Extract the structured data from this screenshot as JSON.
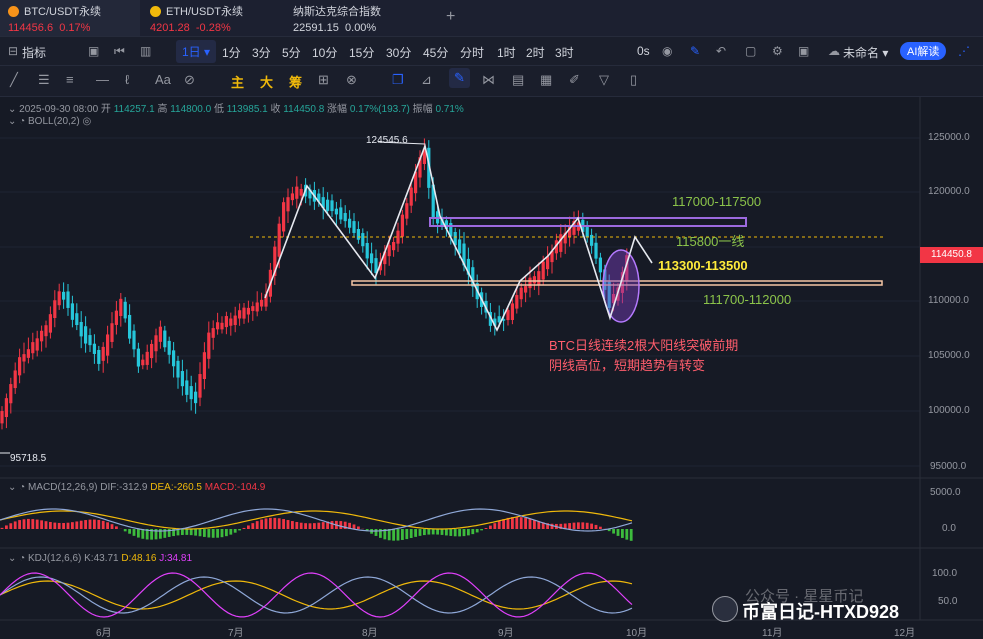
{
  "tabs": [
    {
      "name": "BTC/USDT永续",
      "price": "114456.6",
      "change": "0.17%",
      "color": "#f23645"
    },
    {
      "name": "ETH/USDT永续",
      "price": "4201.28",
      "change": "-0.28%",
      "color": "#f23645"
    },
    {
      "name": "纳斯达克综合指数",
      "price": "22591.15",
      "change": "0.00%",
      "color": "#d1d4dc"
    }
  ],
  "add_tab": "+",
  "toolbar": {
    "indicators": "指标",
    "active_interval": "1日",
    "intervals": [
      "1分",
      "3分",
      "5分",
      "10分",
      "15分",
      "30分",
      "45分",
      "分时",
      "1时",
      "2时",
      "3时"
    ],
    "time_label": "0s",
    "layout_name": "未命名",
    "ai_button": "AI解读"
  },
  "drawing_tools": [
    "主",
    "大",
    "筹"
  ],
  "ohlc": {
    "date": "2025-09-30 08:00",
    "open_label": "开",
    "open": "114257.1",
    "high_label": "高",
    "high": "114800.0",
    "low_label": "低",
    "low": "113985.1",
    "close_label": "收",
    "close": "114450.8",
    "chg_label": "涨幅",
    "chg": "0.17%(193.7)",
    "amp_label": "振幅",
    "amp": "0.71%"
  },
  "boll_label": "BOLL(20,2)",
  "price_axis": [
    "125000.0",
    "120000.0",
    "110000.0",
    "105000.0",
    "100000.0",
    "95000.0"
  ],
  "current_price": "114450.8",
  "high_marker": "124545.6",
  "low_marker": "95718.5",
  "annotations": {
    "zone1": "117000-117500",
    "line1": "115800一线",
    "zone2": "113300-113500",
    "zone3": "111700-112000",
    "note_line1": "BTC日线连续2根大阳线突破前期",
    "note_line2": "阴线高位，短期趋势有转变"
  },
  "macd": {
    "label": "MACD(12,26,9)",
    "dif": "DIF:-312.9",
    "dea": "DEA:-260.5",
    "macd": "MACD:-104.9",
    "axis": [
      "5000.0",
      "0.0"
    ]
  },
  "kdj": {
    "label": "KDJ(12,6,6)",
    "k": "K:43.71",
    "d": "D:48.16",
    "j": "J:34.81",
    "axis": [
      "100.0",
      "50.0"
    ]
  },
  "time_axis": [
    "6月",
    "7月",
    "8月",
    "9月",
    "10月",
    "11月",
    "12月"
  ],
  "watermark": "公众号 · 星星币记",
  "brand": "币富日记-HTXD928",
  "colors": {
    "up": "#f23645",
    "down": "#26c6da",
    "bg": "#161a25",
    "accent": "#2962ff"
  }
}
